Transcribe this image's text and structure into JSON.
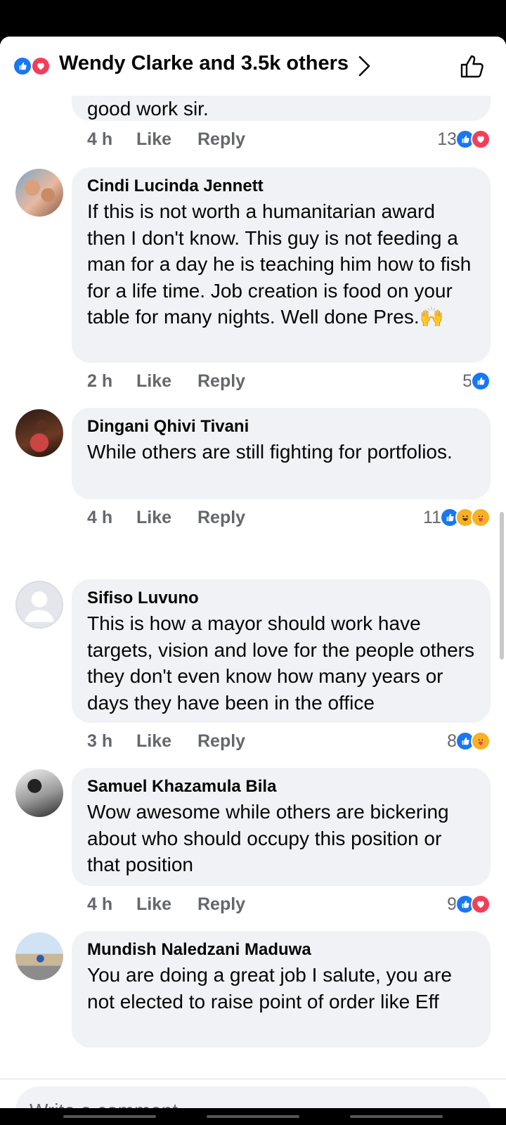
{
  "header": {
    "title": "Wendy Clarke and 3.5k others",
    "reactions": [
      "like",
      "love"
    ]
  },
  "partial_comment": {
    "text_tail": "good work sir.",
    "time": "4 h",
    "like_label": "Like",
    "reply_label": "Reply",
    "reaction_count": "13",
    "reactions": [
      "like",
      "love"
    ]
  },
  "comments": [
    {
      "author": "Cindi Lucinda Jennett",
      "text": "If this is not worth a humanitarian award then I don't know. This guy is not feeding a man for a day he is teaching him how to fish for a life time. Job creation is food on your table for many nights. Well done Pres.🙌",
      "time": "2 h",
      "like_label": "Like",
      "reply_label": "Reply",
      "reaction_count": "5",
      "reactions": [
        "like"
      ],
      "avatar": "photo-children"
    },
    {
      "author": "Dingani Qhivi Tivani",
      "text": "While others are still fighting for portfolios.",
      "time": "4 h",
      "like_label": "Like",
      "reply_label": "Reply",
      "reaction_count": "11",
      "reactions": [
        "like",
        "haha",
        "care"
      ],
      "avatar": "photo-man"
    },
    {
      "author": "Sifiso Luvuno",
      "text": "This is how a mayor should work have targets, vision and love for the people others they don't even know how many years or days they have been in the office",
      "time": "3 h",
      "like_label": "Like",
      "reply_label": "Reply",
      "reaction_count": "8",
      "reactions": [
        "like",
        "care"
      ],
      "avatar": "default-silhouette"
    },
    {
      "author": "Samuel Khazamula Bila",
      "text": "Wow awesome while others are bickering about who should occupy this position or that position",
      "time": "4 h",
      "like_label": "Like",
      "reply_label": "Reply",
      "reaction_count": "9",
      "reactions": [
        "like",
        "love"
      ],
      "avatar": "photo-bw"
    },
    {
      "author": "Mundish Naledzani Maduwa",
      "text": "You are doing a great job  I salute, you are not elected to raise point of order like Eff",
      "avatar": "photo-outdoor"
    }
  ],
  "composer": {
    "placeholder": "Write a comment…"
  },
  "colors": {
    "like_blue": "#1877f2",
    "love_red": "#f33e58",
    "emoji_yellow": "#f7b125",
    "bubble_bg": "#f0f2f5",
    "meta_gray": "#65676b"
  }
}
